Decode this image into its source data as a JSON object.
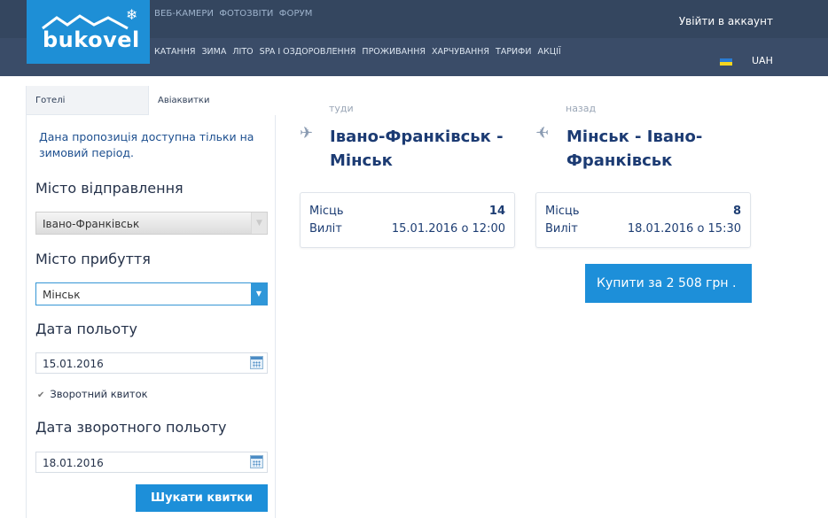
{
  "header": {
    "logo_text": "bukovel",
    "top_nav": [
      "ВЕБ-КАМЕРИ",
      "ФОТОЗВІТИ",
      "ФОРУМ"
    ],
    "main_nav": [
      "КАТАННЯ",
      "ЗИМА",
      "ЛІТО",
      "SPA І ОЗДОРОВЛЕННЯ",
      "ПРОЖИВАННЯ",
      "ХАРЧУВАННЯ",
      "ТАРИФИ",
      "АКЦІЇ"
    ],
    "login": "Увійти в аккаунт",
    "currency": "UAH"
  },
  "tabs": [
    "Готелі",
    "Авіаквитки"
  ],
  "form": {
    "note": "Дана пропозиція доступна тільки на зимовий період.",
    "departure_label": "Місто відправлення",
    "departure_value": "Івано-Франківськ",
    "arrival_label": "Місто прибуття",
    "arrival_value": "Мінськ",
    "date_label": "Дата польоту",
    "date_value": "15.01.2016",
    "return_checkbox_label": "Зворотний квиток",
    "return_date_label": "Дата зворотного польоту",
    "return_date_value": "18.01.2016",
    "search_button": "Шукати квитки"
  },
  "flights": {
    "outbound": {
      "direction": "туди",
      "route_line1": "Івано-Франківськ -",
      "route_line2": "Мінськ",
      "seats_label": "Місць",
      "seats": "14",
      "departure_label": "Виліт",
      "departure": "15.01.2016 о 12:00"
    },
    "return": {
      "direction": "назад",
      "route_line1": "Мінськ - Івано-",
      "route_line2": "Франківськ",
      "seats_label": "Місць",
      "seats": "8",
      "departure_label": "Виліт",
      "departure": "18.01.2016 о 15:30"
    },
    "buy_button": "Купити за 2 508 грн ."
  }
}
